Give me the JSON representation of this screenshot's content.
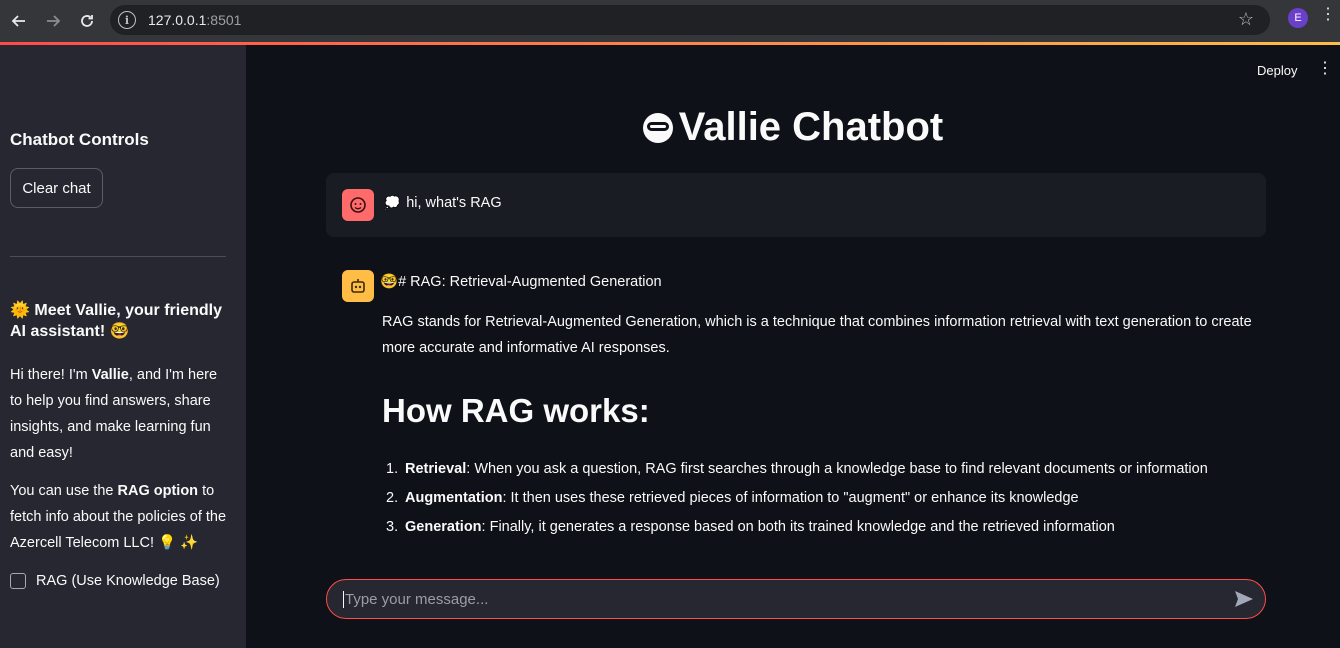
{
  "browser": {
    "url_host": "127.0.0.1",
    "url_port": ":8501",
    "profile_initial": "E"
  },
  "sidebar": {
    "title": "Chatbot Controls",
    "clear_button": "Clear chat",
    "meet_heading": "Meet Vallie, your friendly AI assistant!",
    "intro": {
      "part1": "Hi there! I'm ",
      "name": "Vallie",
      "part2": ", and I'm here to help you find answers, share insights, and make learning fun and easy!"
    },
    "rag_info": {
      "part1": "You can use the ",
      "option": "RAG option",
      "part2": " to fetch info about the policies of the Azercell Telecom LLC! 💡 ✨"
    },
    "rag_checkbox_label": "RAG (Use Knowledge Base)",
    "rag_checked": false
  },
  "header": {
    "deploy_label": "Deploy"
  },
  "main": {
    "title": "Vallie Chatbot",
    "user_message": "hi, what's RAG",
    "assistant": {
      "heading": "# RAG: Retrieval-Augmented Generation",
      "paragraph": "RAG stands for Retrieval-Augmented Generation, which is a technique that combines information retrieval with text generation to create more accurate and informative AI responses.",
      "subheading": "How RAG works:",
      "steps": [
        {
          "num": "1.",
          "term": "Retrieval",
          "text": ": When you ask a question, RAG first searches through a knowledge base to find relevant documents or information"
        },
        {
          "num": "2.",
          "term": "Augmentation",
          "text": ": It then uses these retrieved pieces of information to \"augment\" or enhance its knowledge"
        },
        {
          "num": "3.",
          "term": "Generation",
          "text": ": Finally, it generates a response based on both its trained knowledge and the retrieved information"
        }
      ]
    },
    "chat_input_placeholder": "Type your message..."
  },
  "colors": {
    "accent": "#ff4b4b",
    "user_avatar": "#ff6b6b",
    "bot_avatar": "#ffbd45",
    "sidebar_bg": "#262730",
    "main_bg": "#0e1117"
  }
}
